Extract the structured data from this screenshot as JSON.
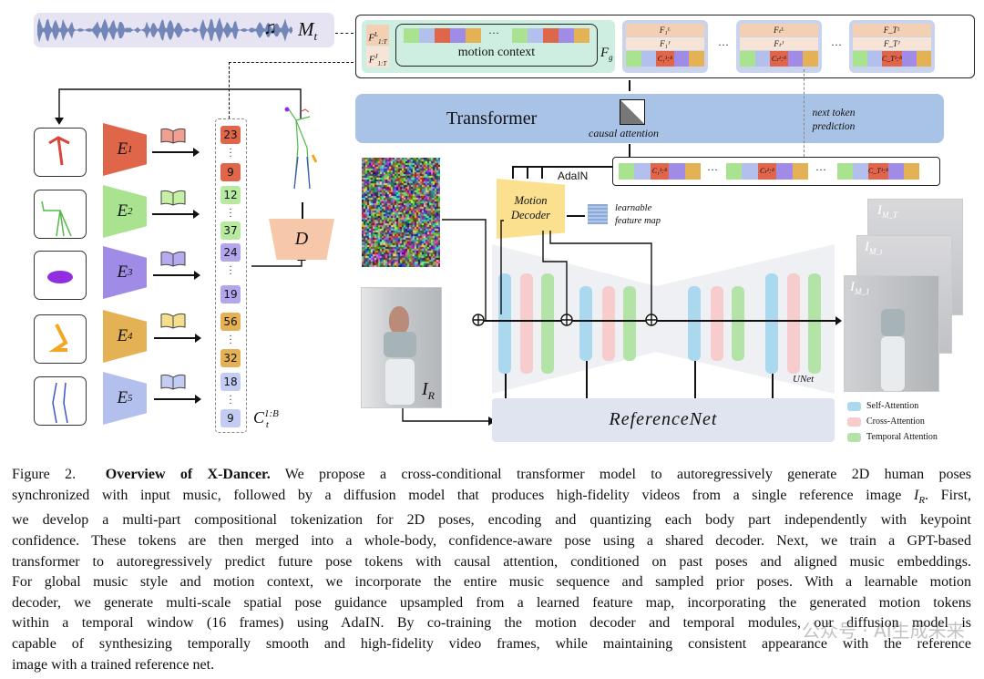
{
  "figure": {
    "music": {
      "label": "M",
      "sub": "t",
      "colors": {
        "bg": "#e6e3f3",
        "wave": "#7286b8"
      }
    },
    "motion_context": {
      "label": "motion context",
      "fg_label": "F",
      "fg_sub": "g",
      "f_labels": [
        {
          "base": "F",
          "sup": "L",
          "sub": "1:T"
        },
        {
          "base": "F",
          "sup": "J",
          "sub": "1:T"
        }
      ],
      "ellipsis": "···"
    },
    "token_groups": [
      {
        "l": "F₁ᴸ",
        "j": "F₁ᴶ",
        "c": "C₁¹:ᴮ"
      },
      {
        "l": "Fₜᴸ",
        "j": "Fₜᴶ",
        "c": "Cₜ¹:ᴮ"
      },
      {
        "l": "F_Tᴸ",
        "j": "F_Tᴶ",
        "c": "C_T¹:ᴮ"
      }
    ],
    "group_ellipsis": "···",
    "transformer": {
      "label": "Transformer",
      "attention_label": "causal attention",
      "next_token": "next token prediction",
      "color": "#a9c3e6"
    },
    "adain_label": "AdaIN",
    "motion_decoder": {
      "label_line1": "Motion",
      "label_line2": "Decoder",
      "color": "#fbe08f"
    },
    "feature_map": {
      "label_line1": "learnable",
      "label_line2": "feature map"
    },
    "unet_label": "UNet",
    "reference_net": {
      "label": "ReferenceNet"
    },
    "reference_image_label": {
      "base": "I",
      "sub": "R"
    },
    "output_frames": [
      {
        "base": "I",
        "sub": "M_T"
      },
      {
        "base": "I",
        "sub": "M_t"
      },
      {
        "base": "I",
        "sub": "M_1"
      }
    ],
    "legend": [
      {
        "label": "Self-Attention",
        "color": "#a9d8ef"
      },
      {
        "label": "Cross-Attention",
        "color": "#f6cccc"
      },
      {
        "label": "Temporal Attention",
        "color": "#b4e3a8"
      }
    ],
    "encoders": [
      {
        "base": "E",
        "sup": "1",
        "color": "#e0664a"
      },
      {
        "base": "E",
        "sup": "2",
        "color": "#a9e38f"
      },
      {
        "base": "E",
        "sup": "3",
        "color": "#a08ce6"
      },
      {
        "base": "E",
        "sup": "4",
        "color": "#e5b155"
      },
      {
        "base": "E",
        "sup": "5",
        "color": "#b3c0ee"
      }
    ],
    "tokens": [
      {
        "value": "23",
        "color": "#e0664a"
      },
      {
        "value": "9",
        "color": "#e0664a"
      },
      {
        "value": "12",
        "color": "#b7eaa0"
      },
      {
        "value": "37",
        "color": "#b7eaa0"
      },
      {
        "value": "24",
        "color": "#b3a6ec"
      },
      {
        "value": "19",
        "color": "#b3a6ec"
      },
      {
        "value": "56",
        "color": "#e5b155"
      },
      {
        "value": "32",
        "color": "#e5b155"
      },
      {
        "value": "18",
        "color": "#c3cdf3"
      },
      {
        "value": "9",
        "color": "#c3cdf3"
      }
    ],
    "token_column_label": {
      "base": "C",
      "sub": "t",
      "sup": "1:B"
    },
    "decoder_label": "D"
  },
  "caption": {
    "figure_label": "Figure 2.",
    "title": "Overview of X-Dancer.",
    "line1": "We propose a cross-conditional transformer model to autoregressively generate 2D human poses",
    "line2_pre": "synchronized with input music, followed by a diffusion model that produces high-fidelity videos from a single reference image",
    "line2_math": "I",
    "line2_math_sub": "R",
    "line2_post": ". First,",
    "lines": [
      "we develop a multi-part compositional tokenization for 2D poses, encoding and quantizing each body part independently with keypoint",
      "confidence. These tokens are then merged into a whole-body, confidence-aware pose using a shared decoder. Next, we train a GPT-based",
      "transformer to autoregressively predict future pose tokens with causal attention, conditioned on past poses and aligned music embeddings.",
      "For global music style and motion context, we incorporate the entire music sequence and sampled prior poses. With a learnable motion",
      "decoder, we generate multi-scale spatial pose guidance upsampled from a learned feature map, incorporating the generated motion tokens",
      "within a temporal window (16 frames) using AdaIN. By co-training the motion decoder and temporal modules, our diffusion model is",
      "capable of synthesizing temporally smooth and high-fidelity video frames, while maintaining consistent appearance with the reference",
      "image with a trained reference net."
    ]
  },
  "watermark": "公众号 · AI生成未来"
}
